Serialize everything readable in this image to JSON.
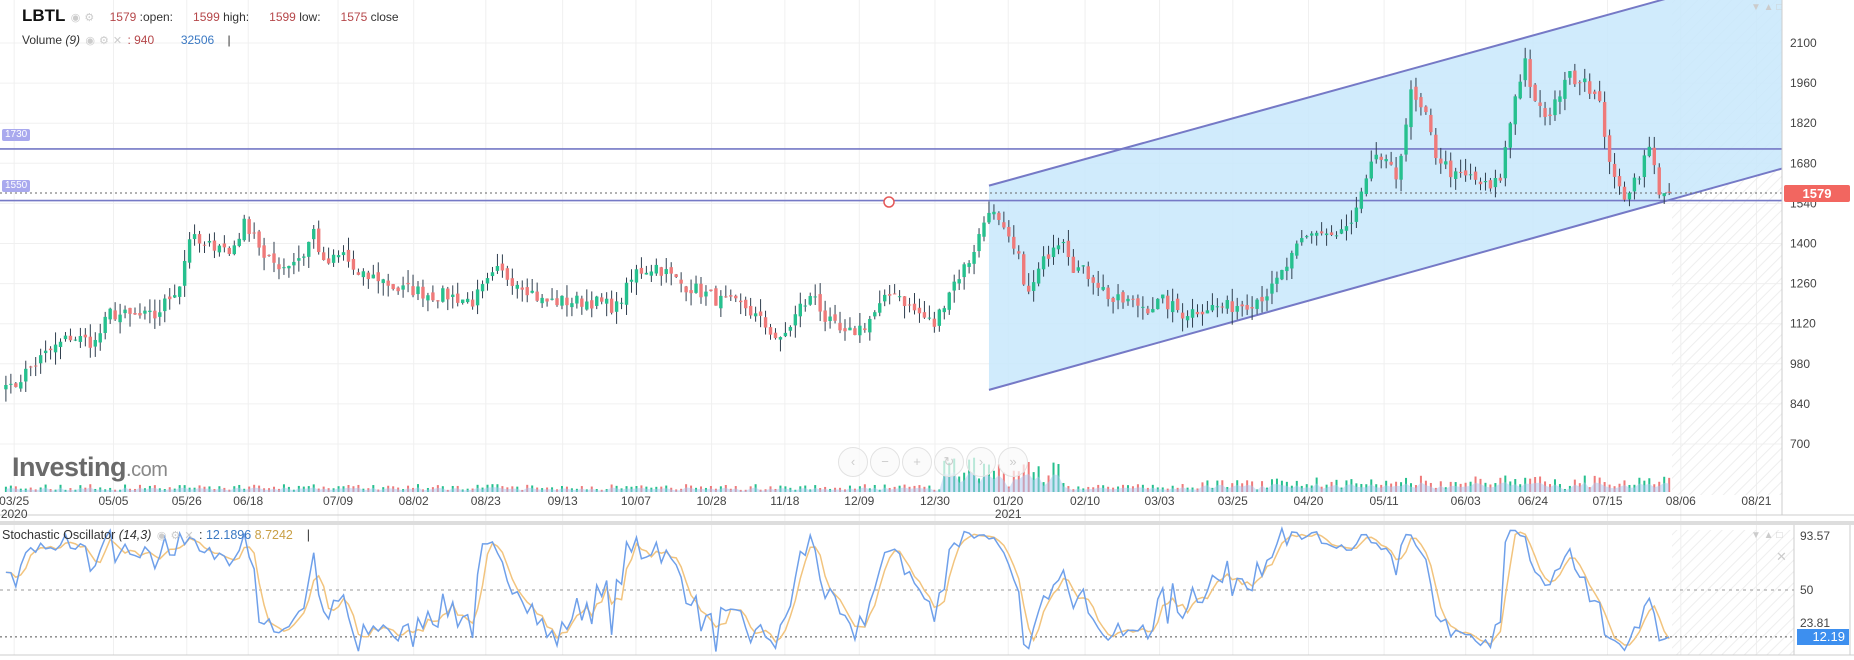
{
  "header": {
    "symbol": "LBTL",
    "open_value": "1579",
    "open_label": ":open:",
    "high_value": "1599",
    "high_label": "high:",
    "low_value": "1599",
    "low_label": "low:",
    "close_value": "1575",
    "close_label": "close",
    "volume_label": "Volume",
    "volume_param": "(9)",
    "volume_value1": ": 940",
    "volume_value2": "32506",
    "cursor": "|"
  },
  "oscillator": {
    "label": "Stochastic Oscillator",
    "param": "(14,3)",
    "k_value": "12.1896",
    "d_value": "8.7242",
    "cursor": "|",
    "ticks": [
      "93.57",
      "50",
      "23.81"
    ],
    "current_tag": "12.19",
    "colors": {
      "k": "#6fa0ea",
      "d": "#f2c47e"
    }
  },
  "logo": {
    "main": "Investing",
    "suffix": ".com"
  },
  "price_tag": "1579",
  "level_badges": [
    "1730",
    "1550"
  ],
  "chart_data": {
    "type": "candlestick",
    "symbol": "LBTL",
    "y_ticks": [
      2100,
      1960,
      1820,
      1680,
      1540,
      1400,
      1260,
      1120,
      980,
      840,
      700
    ],
    "ylim": [
      700,
      2100
    ],
    "x_ticks": [
      "03/25",
      "05/05",
      "05/26",
      "06/18",
      "07/09",
      "08/02",
      "08/23",
      "09/13",
      "10/07",
      "10/28",
      "11/18",
      "12/09",
      "12/30",
      "01/20",
      "02/10",
      "03/03",
      "03/25",
      "04/20",
      "05/11",
      "06/03",
      "06/24",
      "07/15",
      "08/06",
      "08/21"
    ],
    "year_labels": [
      "2020",
      "2021"
    ],
    "last_price": 1579,
    "close_path_day_price": [
      [
        0,
        931
      ],
      [
        1,
        889
      ],
      [
        4,
        951
      ],
      [
        8,
        1013
      ],
      [
        13,
        1075
      ],
      [
        18,
        1054
      ],
      [
        21,
        1157
      ],
      [
        25,
        1145
      ],
      [
        30,
        1145
      ],
      [
        35,
        1260
      ],
      [
        37,
        1425
      ],
      [
        40,
        1383
      ],
      [
        43,
        1404
      ],
      [
        45,
        1363
      ],
      [
        48,
        1466
      ],
      [
        50,
        1445
      ],
      [
        52,
        1342
      ],
      [
        56,
        1322
      ],
      [
        60,
        1363
      ],
      [
        62,
        1445
      ],
      [
        64,
        1322
      ],
      [
        68,
        1363
      ],
      [
        71,
        1281
      ],
      [
        75,
        1281
      ],
      [
        79,
        1239
      ],
      [
        82,
        1239
      ],
      [
        86,
        1219
      ],
      [
        89,
        1219
      ],
      [
        94,
        1198
      ],
      [
        99,
        1301
      ],
      [
        104,
        1260
      ],
      [
        108,
        1198
      ],
      [
        113,
        1198
      ],
      [
        118,
        1198
      ],
      [
        123,
        1178
      ],
      [
        127,
        1301
      ],
      [
        131,
        1322
      ],
      [
        136,
        1260
      ],
      [
        139,
        1239
      ],
      [
        144,
        1198
      ],
      [
        149,
        1178
      ],
      [
        154,
        1095
      ],
      [
        156,
        1054
      ],
      [
        160,
        1178
      ],
      [
        163,
        1219
      ],
      [
        165,
        1136
      ],
      [
        169,
        1075
      ],
      [
        173,
        1116
      ],
      [
        176,
        1178
      ],
      [
        179,
        1239
      ],
      [
        182,
        1178
      ],
      [
        187,
        1116
      ],
      [
        190,
        1239
      ],
      [
        194,
        1342
      ],
      [
        196,
        1425
      ],
      [
        198,
        1528
      ],
      [
        200,
        1466
      ],
      [
        204,
        1342
      ],
      [
        206,
        1219
      ],
      [
        208,
        1301
      ],
      [
        211,
        1404
      ],
      [
        213,
        1425
      ],
      [
        215,
        1322
      ],
      [
        219,
        1281
      ],
      [
        223,
        1198
      ],
      [
        226,
        1198
      ],
      [
        230,
        1178
      ],
      [
        233,
        1198
      ],
      [
        237,
        1157
      ],
      [
        242,
        1178
      ],
      [
        246,
        1178
      ],
      [
        251,
        1198
      ],
      [
        255,
        1239
      ],
      [
        258,
        1322
      ],
      [
        261,
        1404
      ],
      [
        264,
        1445
      ],
      [
        268,
        1425
      ],
      [
        271,
        1466
      ],
      [
        274,
        1610
      ],
      [
        276,
        1713
      ],
      [
        280,
        1631
      ],
      [
        283,
        1919
      ],
      [
        286,
        1836
      ],
      [
        288,
        1713
      ],
      [
        292,
        1631
      ],
      [
        295,
        1631
      ],
      [
        299,
        1589
      ],
      [
        301,
        1631
      ],
      [
        304,
        1919
      ],
      [
        306,
        2042
      ],
      [
        308,
        1878
      ],
      [
        311,
        1836
      ],
      [
        314,
        1981
      ],
      [
        318,
        1981
      ],
      [
        321,
        1878
      ],
      [
        324,
        1610
      ],
      [
        326,
        1569
      ],
      [
        329,
        1651
      ],
      [
        331,
        1733
      ],
      [
        333,
        1589
      ],
      [
        335,
        1579
      ]
    ],
    "drawings": {
      "horizontal_levels": [
        1730,
        1550
      ],
      "channel_upper": [
        [
          198,
          1602
        ],
        [
          333,
          2248
        ]
      ],
      "channel_lower": [
        [
          198,
          889
        ],
        [
          358,
          1663
        ]
      ]
    },
    "colors": {
      "up": "#26c08e",
      "down": "#ef7a7a",
      "channel": "#7579c6",
      "channel_fill": "#c8e7fb"
    }
  }
}
